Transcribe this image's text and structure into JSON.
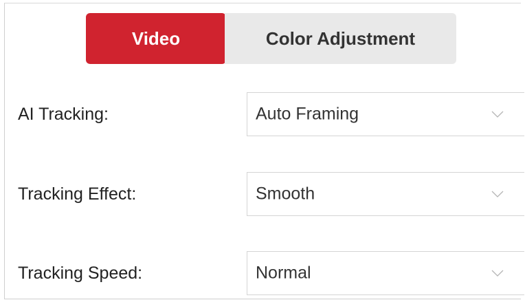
{
  "tabs": [
    {
      "label": "Video",
      "active": true
    },
    {
      "label": "Color Adjustment",
      "active": false
    }
  ],
  "settings": [
    {
      "label": "AI Tracking:",
      "value": "Auto Framing",
      "icon": "chevron-down-icon"
    },
    {
      "label": "Tracking Effect:",
      "value": "Smooth",
      "icon": "chevron-down-icon"
    },
    {
      "label": "Tracking Speed:",
      "value": "Normal",
      "icon": "chevron-down-icon"
    }
  ],
  "colors": {
    "accent": "#d0232f",
    "inactive_tab": "#e9e9e9",
    "border": "#d4d4d4"
  }
}
